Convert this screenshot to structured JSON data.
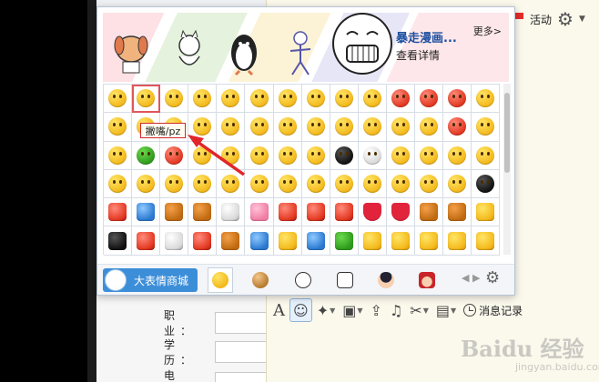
{
  "top_right": {
    "activity_label": "活动",
    "gear_icon": "gear-icon"
  },
  "banner": {
    "title": "暴走漫画...",
    "detail": "查看详情",
    "more": "更多>"
  },
  "tooltip": "撇嘴/pz",
  "bottom": {
    "mall_label": "大表情商城"
  },
  "form": {
    "labels": [
      "职　业：",
      "学　历：",
      "电　话："
    ]
  },
  "edit_toolbar": {
    "history_label": "消息记录"
  },
  "watermark": {
    "brand": "Baidu 经验",
    "url": "jingyan.baidu.com"
  },
  "emoji_rows": [
    [
      "y",
      "y",
      "y",
      "y",
      "y",
      "y",
      "y",
      "y",
      "y",
      "y",
      "r",
      "r",
      "r",
      "y"
    ],
    [
      "y",
      "y",
      "y",
      "y",
      "y",
      "y",
      "y",
      "y",
      "y",
      "y",
      "y",
      "y",
      "r",
      "y"
    ],
    [
      "y",
      "g",
      "r",
      "y",
      "y",
      "y",
      "y",
      "y",
      "k",
      "w",
      "y",
      "y",
      "y",
      "y"
    ],
    [
      "y",
      "y",
      "y",
      "y",
      "y",
      "y",
      "y",
      "y",
      "y",
      "y",
      "y",
      "y",
      "y",
      "k"
    ],
    [
      "red",
      "blue",
      "brown",
      "brown",
      "white",
      "pink",
      "red",
      "red",
      "red",
      "heart",
      "heart",
      "brown",
      "brown",
      "y"
    ],
    [
      "k",
      "r",
      "w",
      "r",
      "brown",
      "blue",
      "y",
      "blue",
      "g",
      "y",
      "y",
      "y",
      "y",
      "y"
    ]
  ],
  "colors": {
    "accent": "#3d8ed8",
    "highlight": "#d12a2a"
  }
}
